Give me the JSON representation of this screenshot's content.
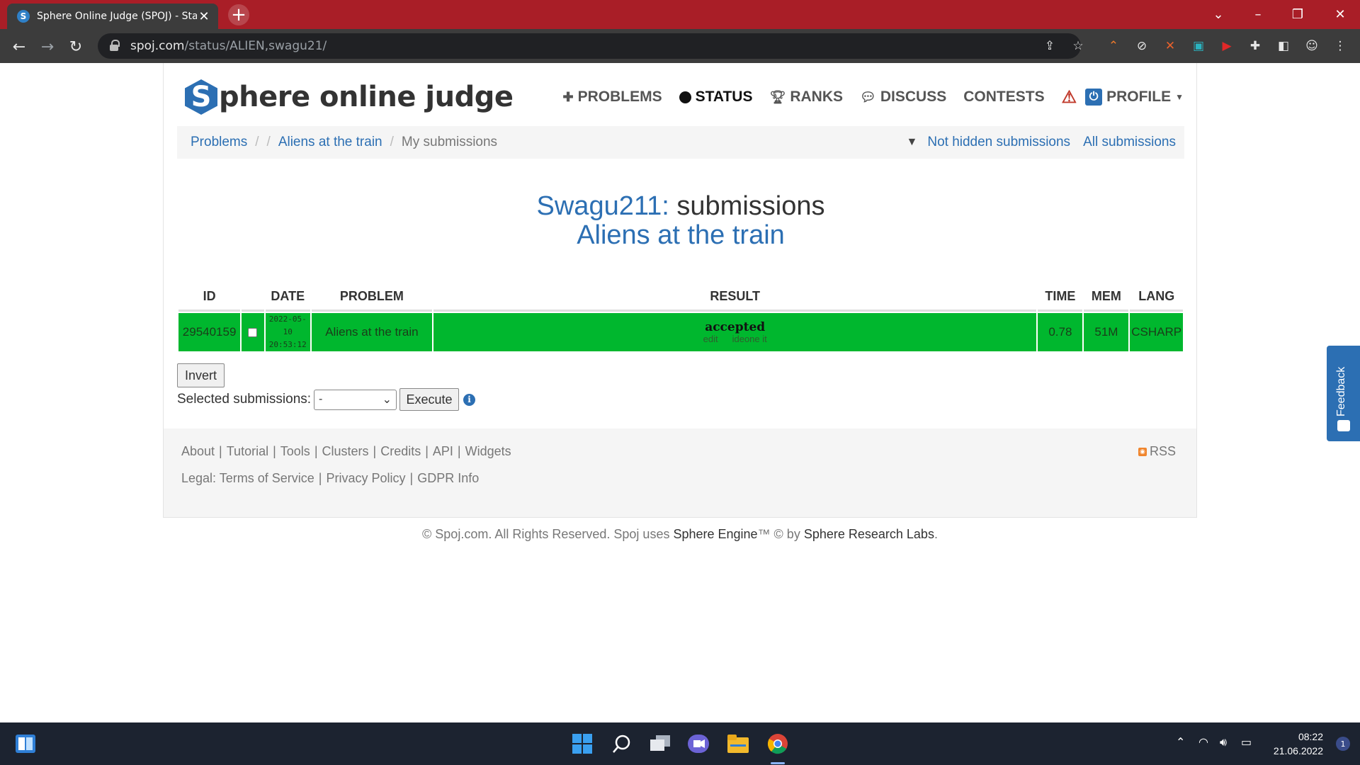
{
  "browser": {
    "tab_title": "Sphere Online Judge (SPOJ) - Sta",
    "tab_favicon": "S",
    "url_host": "spoj.com",
    "url_path": "/status/ALIEN,swagu21/"
  },
  "site": {
    "logo_letter": "S",
    "logo_text": "phere online judge",
    "nav": {
      "problems": "PROBLEMS",
      "status": "STATUS",
      "ranks": "RANKS",
      "discuss": "DISCUSS",
      "contests": "CONTESTS",
      "profile": "PROFILE"
    }
  },
  "breadcrumb": {
    "problems": "Problems",
    "problem": "Aliens at the train",
    "current": "My submissions",
    "not_hidden": "Not hidden submissions",
    "all": "All submissions"
  },
  "heading": {
    "user": "Swagu211:",
    "word": "submissions",
    "problem": "Aliens at the train"
  },
  "table": {
    "headers": [
      "ID",
      "DATE",
      "PROBLEM",
      "RESULT",
      "TIME",
      "MEM",
      "LANG"
    ],
    "rows": [
      {
        "id": "29540159",
        "date": "2022-05-10",
        "time_of_day": "20:53:12",
        "problem": "Aliens at the train",
        "result": "accepted",
        "edit": "edit",
        "ideone": "ideone it",
        "time": "0.78",
        "mem": "51M",
        "lang": "CSHARP"
      }
    ],
    "row_color": "#00b72e"
  },
  "controls": {
    "invert": "Invert",
    "selected_label": "Selected submissions:",
    "select_value": "-",
    "execute": "Execute",
    "info": "i"
  },
  "footer": {
    "about": "About",
    "tutorial": "Tutorial",
    "tools": "Tools",
    "clusters": "Clusters",
    "credits": "Credits",
    "api": "API",
    "widgets": "Widgets",
    "legal": "Legal:",
    "terms": "Terms of Service",
    "privacy": "Privacy Policy",
    "gdpr": "GDPR Info",
    "rss": "RSS"
  },
  "copyright": {
    "pre": "© Spoj.com. All Rights Reserved. Spoj uses ",
    "engine": "Sphere Engine",
    "mid": "™ © by ",
    "labs": "Sphere Research Labs",
    "post": "."
  },
  "feedback": "Feedback",
  "taskbar": {
    "time": "08:22",
    "date": "21.06.2022",
    "notifications": "1"
  }
}
